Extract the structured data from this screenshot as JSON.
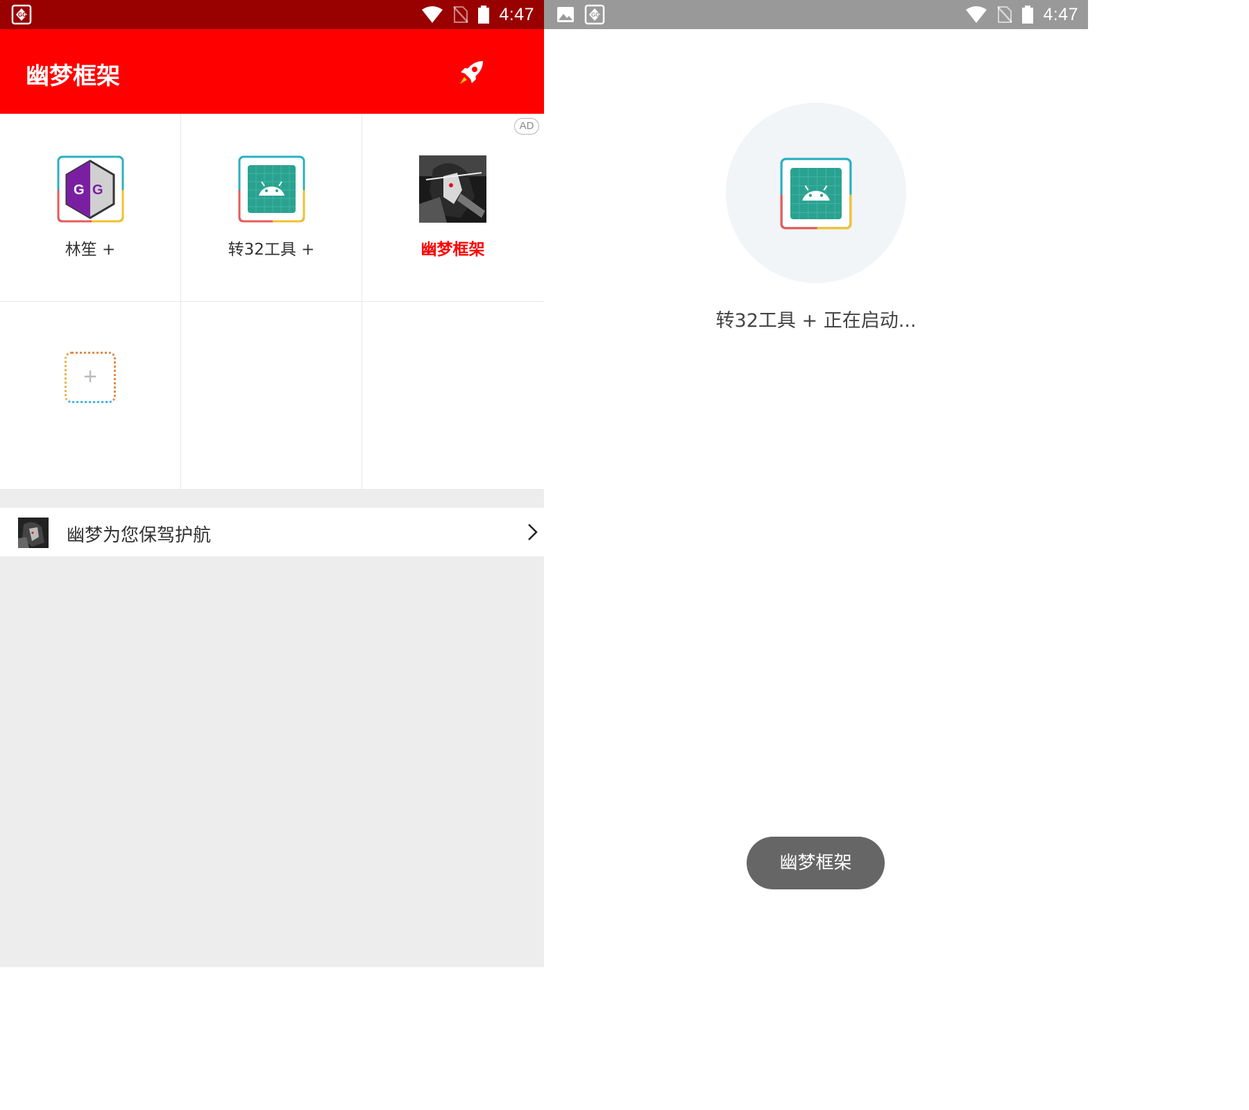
{
  "colors": {
    "accent": "#ff0000",
    "statusbar_left": "#990000",
    "statusbar_right": "#999999",
    "android_teal": "#2ba291"
  },
  "left": {
    "statusbar": {
      "time": "4:47",
      "icons": [
        "gg-notification-icon",
        "wifi-icon",
        "no-sim-icon",
        "battery-icon"
      ]
    },
    "appbar": {
      "title": "幽梦框架",
      "action_icon": "rocket-icon"
    },
    "grid": {
      "items": [
        {
          "label": "林笙 +",
          "icon": "game-guardian-icon"
        },
        {
          "label": "转32工具 +",
          "icon": "android-app-icon"
        },
        {
          "label": "幽梦框架",
          "icon": "anime-character-icon",
          "badge": "AD"
        },
        {
          "label": "+",
          "icon": "add-app-icon"
        }
      ]
    },
    "notice": {
      "text": "幽梦为您保驾护航",
      "icon": "thumbnail-icon",
      "trailing_icon": "chevron-right-icon"
    }
  },
  "right": {
    "statusbar": {
      "time": "4:47",
      "icons": [
        "image-notification-icon",
        "gg-notification-icon",
        "wifi-icon",
        "no-sim-icon",
        "battery-icon"
      ]
    },
    "splash": {
      "text": "转32工具 + 正在启动...",
      "icon": "android-app-icon"
    },
    "toast": {
      "text": "幽梦框架"
    }
  }
}
